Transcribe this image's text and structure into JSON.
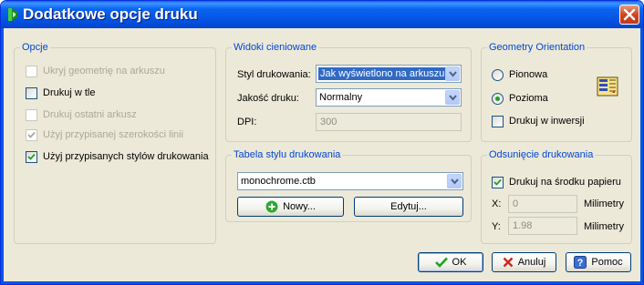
{
  "window": {
    "title": "Dodatkowe opcje druku"
  },
  "options": {
    "legend": "Opcje",
    "items": [
      {
        "label": "Ukryj geometrię na arkuszu",
        "checked": false,
        "enabled": false
      },
      {
        "label": "Drukuj w tle",
        "checked": false,
        "enabled": true
      },
      {
        "label": "Drukuj ostatni arkusz",
        "checked": false,
        "enabled": false
      },
      {
        "label": "Użyj przypisanej szerokości linii",
        "checked": true,
        "enabled": false
      },
      {
        "label": "Użyj przypisanych stylów drukowania",
        "checked": true,
        "enabled": true
      }
    ]
  },
  "shaded": {
    "legend": "Widoki cieniowane",
    "style_label": "Styl drukowania:",
    "style_value": "Jak wyświetlono na arkuszu",
    "quality_label": "Jakość druku:",
    "quality_value": "Normalny",
    "dpi_label": "DPI:",
    "dpi_value": "300"
  },
  "plot_style": {
    "legend": "Tabela stylu drukowania",
    "table_value": "monochrome.ctb",
    "new_label": "Nowy...",
    "edit_label": "Edytuj..."
  },
  "orientation": {
    "legend": "Geometry Orientation",
    "portrait_label": "Pionowa",
    "landscape_label": "Pozioma",
    "landscape_selected": true,
    "inverse_label": "Drukuj w inwersji",
    "icon": "landscape-orientation-icon"
  },
  "offset": {
    "legend": "Odsunięcie drukowania",
    "center_label": "Drukuj na środku papieru",
    "center_checked": true,
    "x_label": "X:",
    "x_value": "0",
    "x_unit": "Milimetry",
    "y_label": "Y:",
    "y_value": "1.98",
    "y_unit": "Milimetry"
  },
  "buttons": {
    "ok_label": "OK",
    "cancel_label": "Anuluj",
    "help_label": "Pomoc"
  },
  "colors": {
    "title_bar": "#0454e1",
    "legend_text": "#0046d5",
    "dialog_bg": "#ece9d8",
    "close_button": "#d2451f",
    "check_mark": "#21a121"
  }
}
